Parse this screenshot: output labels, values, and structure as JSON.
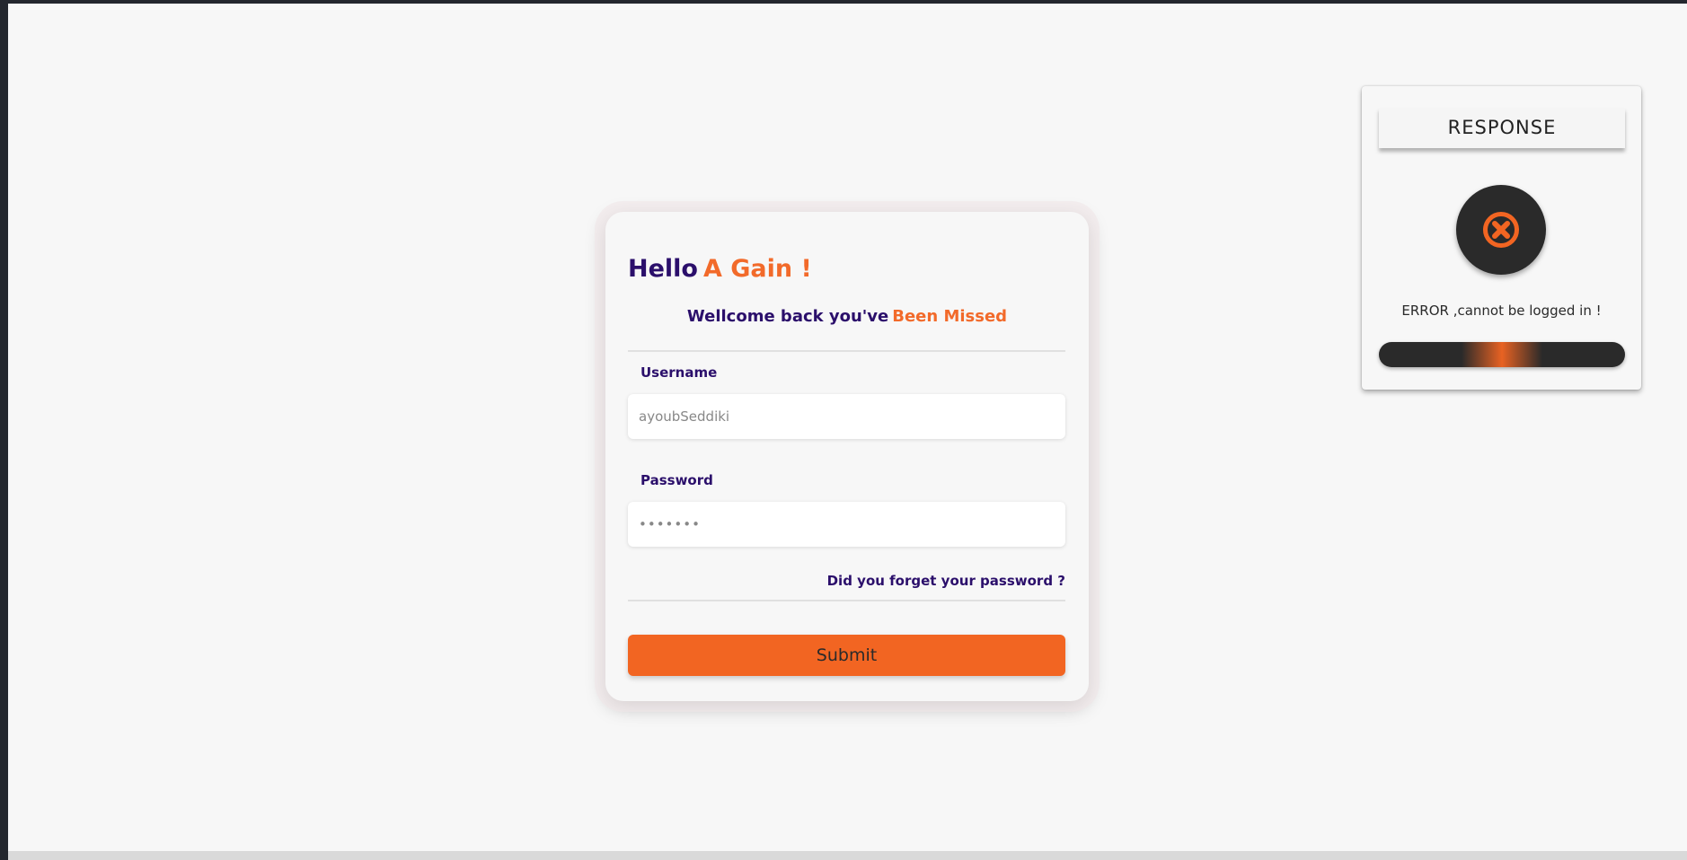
{
  "login": {
    "greeting_part1": "Hello",
    "greeting_part2": "A Gain !",
    "welcome_part1": "Wellcome back you've",
    "welcome_part2": "Been Missed",
    "username_label": "Username",
    "username_value": "ayoubSeddiki",
    "password_label": "Password",
    "password_value": "•••••••",
    "forgot_link": "Did you forget your password ?",
    "submit_label": "Submit"
  },
  "response": {
    "title": "RESPONSE",
    "status_icon": "x-circle-icon",
    "message": "ERROR ,cannot be logged in !",
    "progress": 0.5
  },
  "colors": {
    "primary": "#2b0f6b",
    "accent": "#f26522",
    "dark": "#2a2a2a",
    "background": "#f7f7f7"
  }
}
